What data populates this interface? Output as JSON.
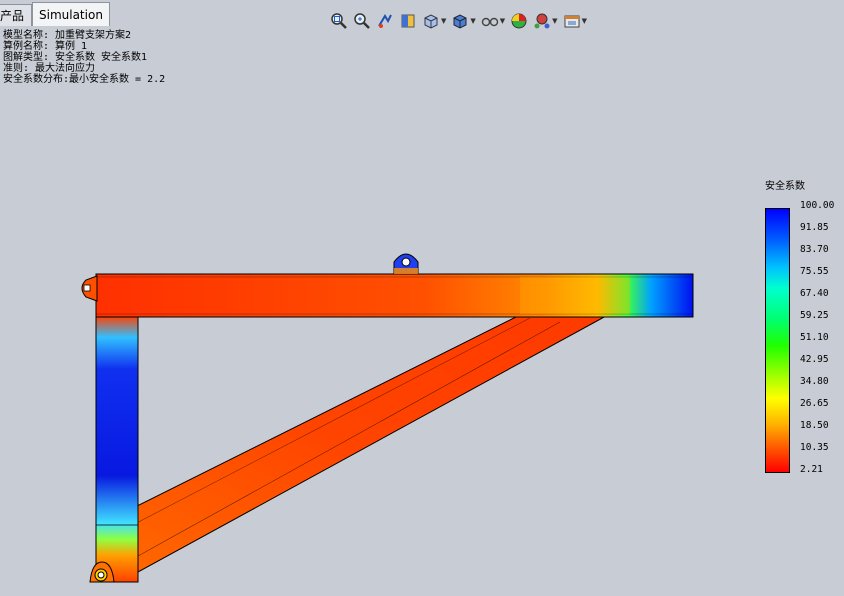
{
  "tabs": [
    {
      "label": "产品",
      "active": false
    },
    {
      "label": "Simulation",
      "active": true
    }
  ],
  "toolbar": {
    "icons": [
      "zoom-fit-icon",
      "zoom-area-icon",
      "previous-view-icon",
      "section-view-icon",
      "view-orientation-icon",
      "display-style-icon",
      "hide-show-icon",
      "edit-appearance-icon",
      "apply-scene-icon",
      "view-settings-icon"
    ]
  },
  "info": {
    "model_name": "模型名称: 加重臂支架方案2",
    "study_name": "算例名称: 算例 1",
    "plot_type": "图解类型: 安全系数 安全系数1",
    "criterion": "准则: 最大法向应力",
    "distribution": "安全系数分布:最小安全系数 = 2.2"
  },
  "legend": {
    "title": "安全系数",
    "labels": [
      "100.00",
      "91.85",
      "83.70",
      "75.55",
      "67.40",
      "59.25",
      "51.10",
      "42.95",
      "34.80",
      "26.65",
      "18.50",
      "10.35",
      "2.21"
    ]
  },
  "colors": {
    "background": "#c8ccd4",
    "low_fos": "#ff4000",
    "high_fos": "#0000ff"
  }
}
